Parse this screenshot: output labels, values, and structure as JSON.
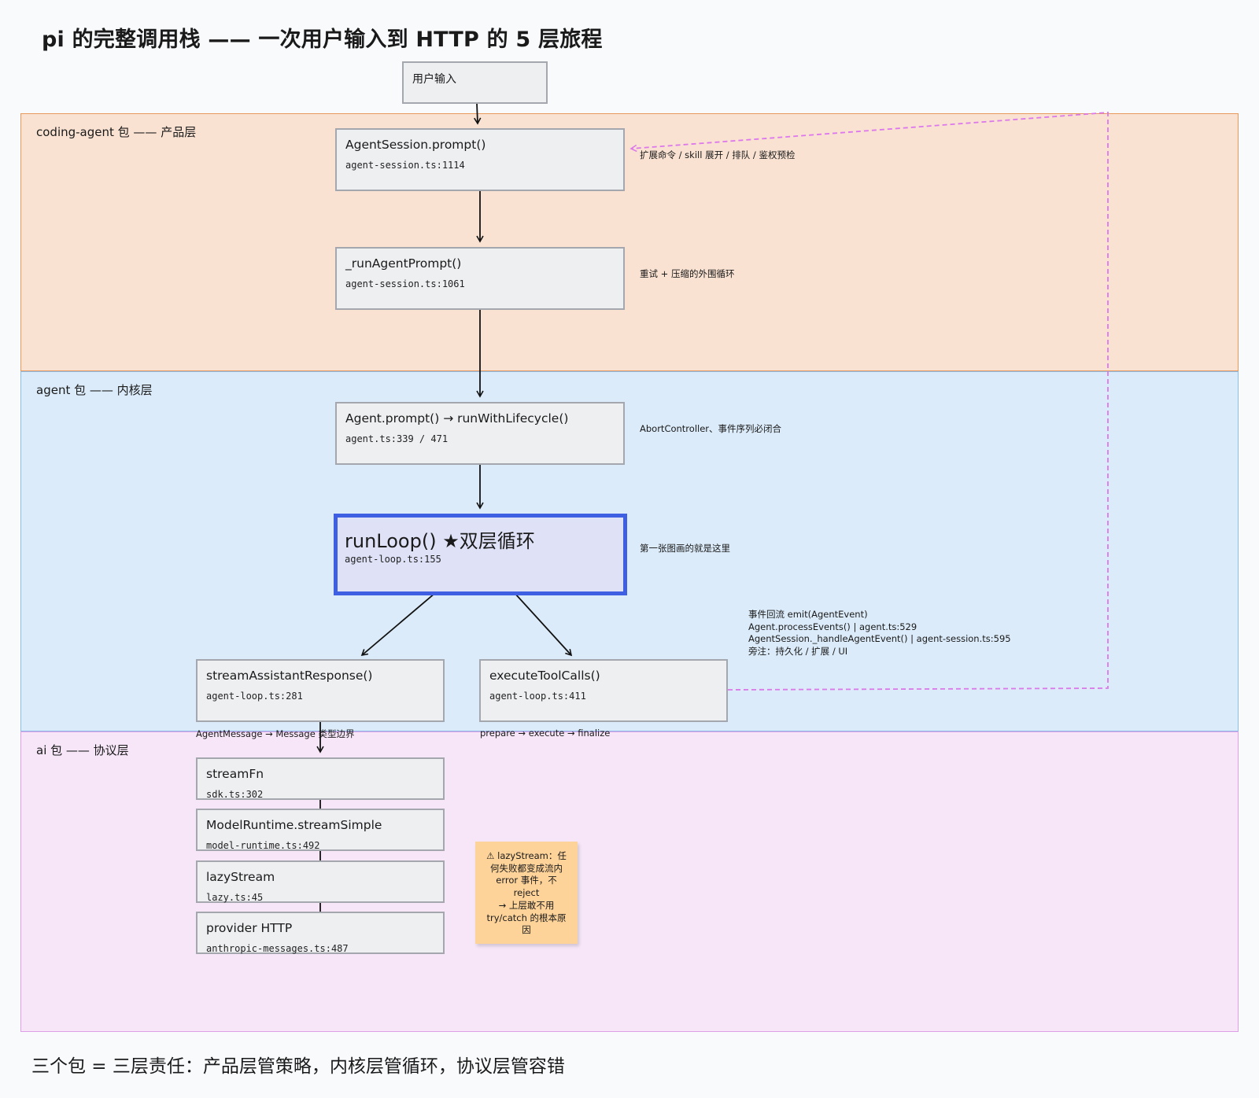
{
  "title": "pi 的完整调用栈 —— 一次用户输入到 HTTP 的 5 层旅程",
  "footer": "三个包 = 三层责任：产品层管策略，内核层管循环，协议层管容错",
  "regions": {
    "coding_agent": "coding-agent 包 —— 产品层",
    "agent": "agent 包 —— 内核层",
    "ai": "ai 包 —— 协议层"
  },
  "nodes": {
    "user_input": {
      "fn": "用户输入"
    },
    "agent_session_prompt": {
      "fn": "AgentSession.prompt()",
      "file": "agent-session.ts:1114"
    },
    "run_agent_prompt": {
      "fn": "_runAgentPrompt()",
      "file": "agent-session.ts:1061"
    },
    "agent_prompt": {
      "fn": "Agent.prompt() → runWithLifecycle()",
      "file": "agent.ts:339 / 471"
    },
    "run_loop": {
      "fn": "runLoop() ★双层循环",
      "file": "agent-loop.ts:155"
    },
    "stream_assistant": {
      "fn": "streamAssistantResponse()",
      "file": "agent-loop.ts:281"
    },
    "execute_tools": {
      "fn": "executeToolCalls()",
      "file": "agent-loop.ts:411"
    },
    "stream_fn": {
      "fn": "streamFn",
      "file": "sdk.ts:302"
    },
    "model_runtime": {
      "fn": "ModelRuntime.streamSimple",
      "file": "model-runtime.ts:492"
    },
    "lazy_stream": {
      "fn": "lazyStream",
      "file": "lazy.ts:45"
    },
    "provider_http": {
      "fn": "provider HTTP",
      "file": "anthropic-messages.ts:487"
    }
  },
  "notes": {
    "agent_session_prompt": "扩展命令 / skill 展开 / 排队 / 鉴权预检",
    "run_agent_prompt": "重试 + 压缩的外围循环",
    "agent_prompt": "AbortController、事件序列必闭合",
    "run_loop": "第一张图画的就是这里",
    "event_flow": [
      "事件回流 emit(AgentEvent)",
      "Agent.processEvents() | agent.ts:529",
      "AgentSession._handleAgentEvent() | agent-session.ts:595",
      "旁注：持久化 / 扩展 / UI"
    ],
    "edge_stream": "AgentMessage → Message 类型边界",
    "edge_tools": "prepare → execute → finalize"
  },
  "sticky": [
    "⚠ lazyStream：任",
    "何失败都变成流内",
    "error 事件，不",
    "reject",
    "→ 上层敢不用",
    "try/catch 的根本原",
    "因"
  ],
  "colors": {
    "product_fill": "#f9e2d2",
    "kernel_fill": "#dbebf9",
    "protocol_fill": "#f6e6f8",
    "highlight_border": "#3f5fe2",
    "event_dash": "#dc78ec",
    "sticky": "#fed39a"
  }
}
